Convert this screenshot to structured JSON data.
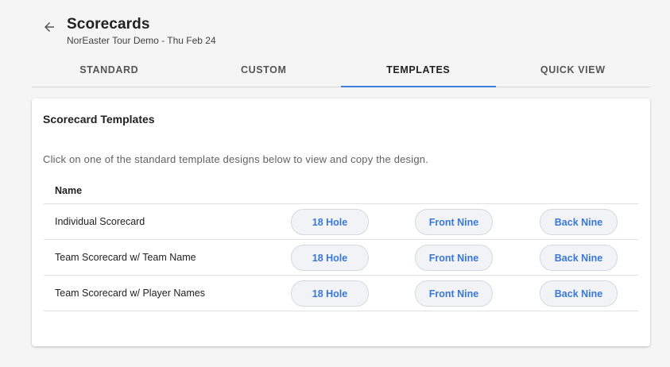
{
  "header": {
    "title": "Scorecards",
    "subtitle": "NorEaster Tour Demo - Thu Feb 24"
  },
  "tabs": [
    {
      "label": "STANDARD",
      "active": false
    },
    {
      "label": "CUSTOM",
      "active": false
    },
    {
      "label": "TEMPLATES",
      "active": true
    },
    {
      "label": "QUICK VIEW",
      "active": false
    }
  ],
  "card": {
    "title": "Scorecard Templates",
    "description": "Click on one of the standard template designs below to view and copy the design.",
    "column_header": "Name",
    "rows": [
      {
        "name": "Individual Scorecard",
        "buttons": [
          "18 Hole",
          "Front Nine",
          "Back Nine"
        ]
      },
      {
        "name": "Team Scorecard w/ Team Name",
        "buttons": [
          "18 Hole",
          "Front Nine",
          "Back Nine"
        ]
      },
      {
        "name": "Team Scorecard w/ Player Names",
        "buttons": [
          "18 Hole",
          "Front Nine",
          "Back Nine"
        ]
      }
    ]
  },
  "icons": {
    "back": "arrow-left-icon"
  },
  "colors": {
    "accent": "#3f7fe0",
    "button_text": "#3a78d6"
  }
}
